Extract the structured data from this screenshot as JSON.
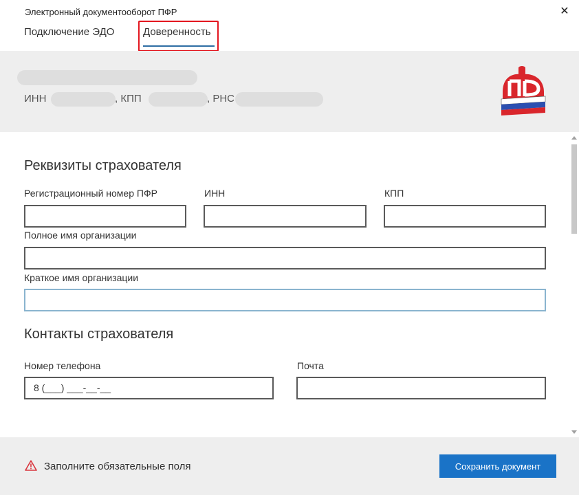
{
  "window": {
    "title": "Электронный документооборот ПФР",
    "close_glyph": "✕"
  },
  "tabs": [
    {
      "label": "Подключение ЭДО",
      "active": false
    },
    {
      "label": "Доверенность",
      "active": true
    }
  ],
  "org": {
    "inn_label": "ИНН",
    "kpp_label": ", КПП",
    "rns_label": ", РНС",
    "logo_icon": "pfr-logo-icon"
  },
  "insurer_details": {
    "title": "Реквизиты страхователя",
    "reg_number_label": "Регистрационный номер ПФР",
    "reg_number_value": "",
    "inn_label": "ИНН",
    "inn_value": "",
    "kpp_label": "КПП",
    "kpp_value": "",
    "full_name_label": "Полное имя организации",
    "full_name_value": "",
    "short_name_label": "Краткое имя организации",
    "short_name_value": ""
  },
  "insurer_contacts": {
    "title": "Контакты страхователя",
    "phone_label": "Номер телефона",
    "phone_value": "8 (___) ___-__-__",
    "email_label": "Почта",
    "email_value": ""
  },
  "footer": {
    "warning_icon": "warning-triangle-icon",
    "warning_text": "Заполните обязательные поля",
    "save_label": "Сохранить документ"
  },
  "colors": {
    "accent": "#1a73c7",
    "tab_underline": "#2d6da3",
    "highlight": "#e3161f",
    "warning": "#d9363e",
    "panel_bg": "#eeeeee"
  }
}
